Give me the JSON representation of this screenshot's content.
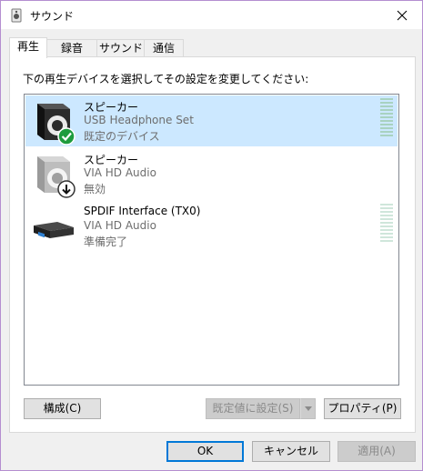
{
  "window": {
    "title": "サウンド"
  },
  "tabs": [
    {
      "label": "再生"
    },
    {
      "label": "録音"
    },
    {
      "label": "サウンド"
    },
    {
      "label": "通信"
    }
  ],
  "panel": {
    "instruction": "下の再生デバイスを選択してその設定を変更してください:"
  },
  "devices": [
    {
      "name": "スピーカー",
      "description": "USB Headphone Set",
      "status": "既定のデバイス",
      "badge": "check-icon",
      "selected": true
    },
    {
      "name": "スピーカー",
      "description": "VIA HD Audio",
      "status": "無効",
      "badge": "down-arrow-icon",
      "selected": false
    },
    {
      "name": "SPDIF Interface (TX0)",
      "description": "VIA HD Audio",
      "status": "準備完了",
      "badge": "",
      "selected": false
    }
  ],
  "buttons": {
    "configure": "構成(C)",
    "set_default": "既定値に設定(S)",
    "properties": "プロパティ(P)",
    "ok": "OK",
    "cancel": "キャンセル",
    "apply": "適用(A)"
  },
  "colors": {
    "selection": "#cce8ff",
    "check_badge": "#1e9c3e",
    "default_button_border": "#0078d7"
  }
}
